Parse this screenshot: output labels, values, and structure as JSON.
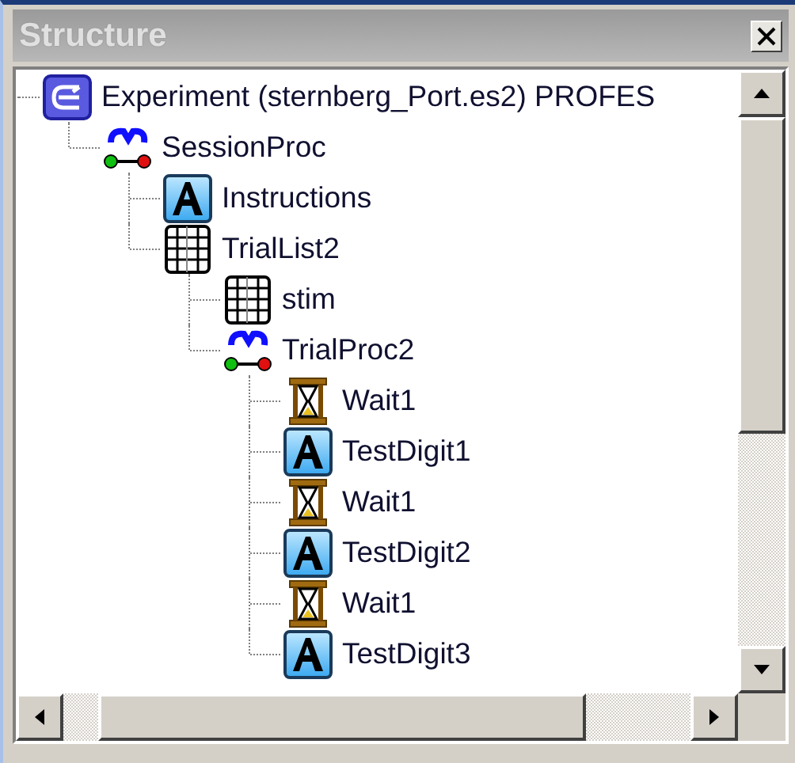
{
  "panel": {
    "title": "Structure"
  },
  "tree": [
    {
      "kind": "experiment",
      "label": "Experiment (sternberg_Port.es2) PROFES",
      "children": [
        {
          "kind": "procedure",
          "label": "SessionProc",
          "children": [
            {
              "kind": "text",
              "label": "Instructions"
            },
            {
              "kind": "list",
              "label": "TrialList2",
              "children": [
                {
                  "kind": "list",
                  "label": "stim"
                },
                {
                  "kind": "procedure",
                  "label": "TrialProc2",
                  "children": [
                    {
                      "kind": "wait",
                      "label": "Wait1"
                    },
                    {
                      "kind": "text",
                      "label": "TestDigit1"
                    },
                    {
                      "kind": "wait",
                      "label": "Wait1"
                    },
                    {
                      "kind": "text",
                      "label": "TestDigit2"
                    },
                    {
                      "kind": "wait",
                      "label": "Wait1"
                    },
                    {
                      "kind": "text",
                      "label": "TestDigit3"
                    }
                  ]
                }
              ]
            }
          ]
        }
      ]
    }
  ]
}
